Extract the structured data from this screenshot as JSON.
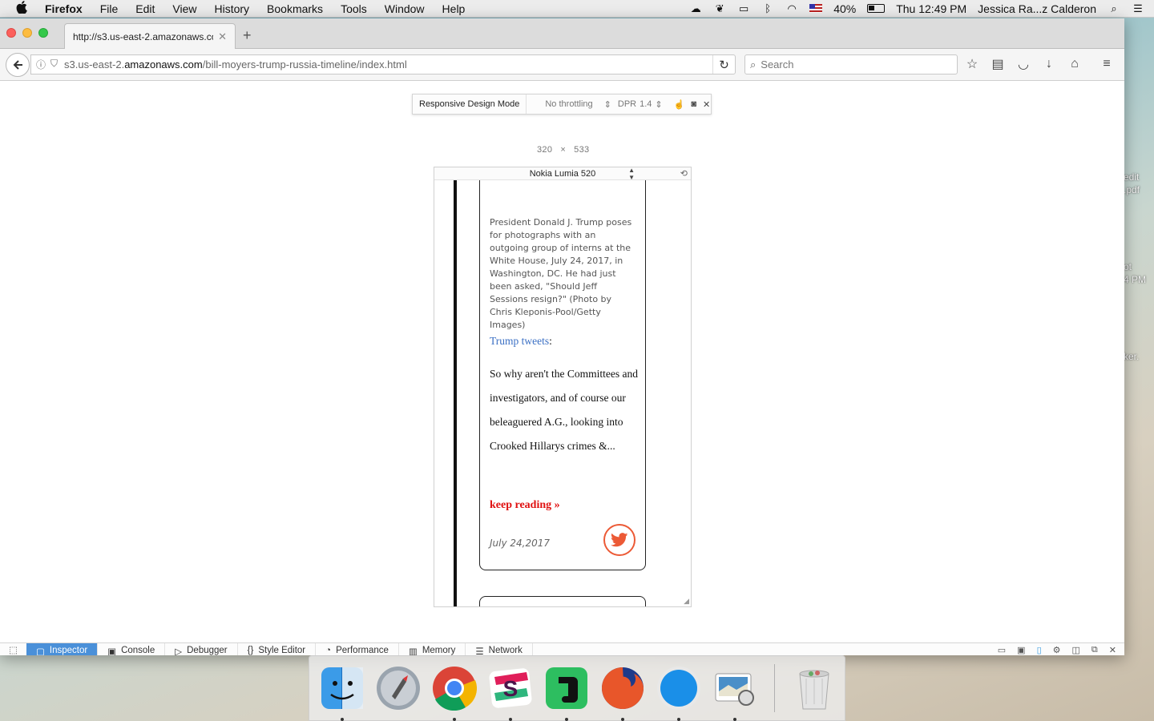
{
  "menubar": {
    "app_name": "Firefox",
    "items": [
      "File",
      "Edit",
      "View",
      "History",
      "Bookmarks",
      "Tools",
      "Window",
      "Help"
    ],
    "battery": "40%",
    "clock": "Thu 12:49 PM",
    "user": "Jessica Ra...z Calderon"
  },
  "desktop": {
    "label1a": "edit",
    "label1b": ".pdf",
    "label2a": "ot",
    "label2b": "4 PM",
    "label3": "ker."
  },
  "browser": {
    "tab_title": "http://s3.us-east-2.amazonaws.co",
    "url_prefix": "s3.us-east-2.",
    "url_domain": "amazonaws.com",
    "url_path": "/bill-moyers-trump-russia-timeline/index.html",
    "search_placeholder": "Search"
  },
  "rdm": {
    "title": "Responsive Design Mode",
    "throttling": "No throttling",
    "dpr_label": "DPR",
    "dpr_value": "1.4",
    "width": "320",
    "times": "×",
    "height": "533",
    "device": "Nokia Lumia 520"
  },
  "page": {
    "caption": "President Donald J. Trump poses for photographs with an outgoing group of interns at the White House, July 24, 2017, in Washington, DC. He had just been asked, \"Should Jeff Sessions resign?\" (Photo by Chris Kleponis-Pool/Getty Images)",
    "tweets_link": "Trump tweets",
    "tweets_colon": ":",
    "tweet_text": "So why aren't the Committees and investigators, and of course our beleaguered A.G., looking into Crooked Hillarys crimes &...",
    "keep_reading": "keep reading »",
    "date": "July 24,2017"
  },
  "devtools": {
    "tabs": [
      "Inspector",
      "Console",
      "Debugger",
      "Style Editor",
      "Performance",
      "Memory",
      "Network"
    ]
  },
  "dock": {
    "apps": [
      "finder-icon",
      "launchpad-icon",
      "chrome-icon",
      "slack-icon",
      "evernote-icon",
      "firefox-icon",
      "safari-icon",
      "preview-icon",
      "trash-icon"
    ]
  },
  "colors": {
    "accent_red": "#e01010",
    "twitter_ring": "#ec5a36",
    "link_blue": "#3a6fc4",
    "devtools_active": "#4a90d9"
  }
}
